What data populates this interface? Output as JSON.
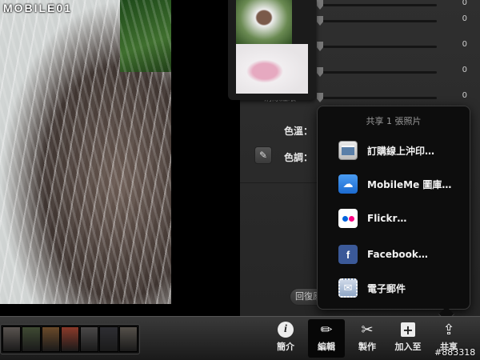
{
  "watermark": "MOBILE01",
  "photo_id": "#883318",
  "edit_panel": {
    "slider_values": [
      "0",
      "0",
      "0",
      "0",
      "0"
    ],
    "partial_label": "消除紅眼",
    "color_temp_label": "色溫：",
    "tint_label": "色調：",
    "revert_label": "回復原始"
  },
  "share_popover": {
    "title": "共享 1 張照片",
    "items": [
      {
        "label": "訂購線上沖印…",
        "icon": "print-icon"
      },
      {
        "label": "MobileMe 圖庫…",
        "icon": "cloud-icon"
      },
      {
        "label": "Flickr…",
        "icon": "flickr-icon"
      },
      {
        "label": "Facebook…",
        "icon": "facebook-icon"
      },
      {
        "label": "電子郵件",
        "icon": "mail-stamp-icon"
      }
    ]
  },
  "toolbar": {
    "info": "簡介",
    "edit": "編輯",
    "create": "製作",
    "add_to": "加入至",
    "share": "共享"
  },
  "filmstrip_colors": [
    "#5a5450",
    "#3f4a33",
    "#6a4a2a",
    "#8a3a2a",
    "#4a4848",
    "#2e2e33",
    "#55504a"
  ]
}
